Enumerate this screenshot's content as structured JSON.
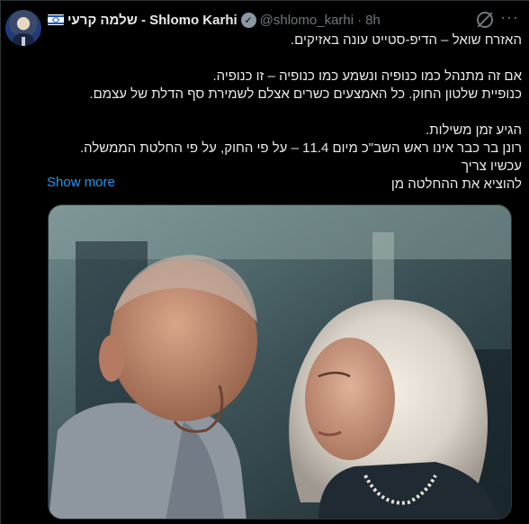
{
  "tweet": {
    "display_name": "שלמה קרעי - Shlomo Karhi",
    "handle": "@shlomo_karhi",
    "separator": "·",
    "time": "8h",
    "body": [
      "האזרח שואל – הדיפ-סטייט עונה באזיקים.",
      "",
      "אם זה מתנהל כמו כנופיה ונשמע כמו כנופיה – זו כנופיה.",
      "כנופיית שלטון החוק. כל האמצעים כשרים אצלם לשמירת סף הדלת של עצמם.",
      "",
      "הגיע זמן משילות.",
      "רונן בר כבר אינו ראש השב\"כ מיום 11.4 – על פי החוק, על פי החלטת הממשלה. עכשיו צריך",
      "להוציא את ההחלטה מן"
    ],
    "show_more_label": "Show more"
  },
  "icons": {
    "avatar": "profile-avatar",
    "flag": "israel-flag-icon",
    "verified": "verified-badge-icon",
    "grok": "grok-icon",
    "more": "more-options-icon"
  },
  "colors": {
    "background": "#000000",
    "text": "#e7e9ea",
    "muted": "#71767b",
    "link": "#1d9bf0",
    "border": "#2f3336"
  }
}
